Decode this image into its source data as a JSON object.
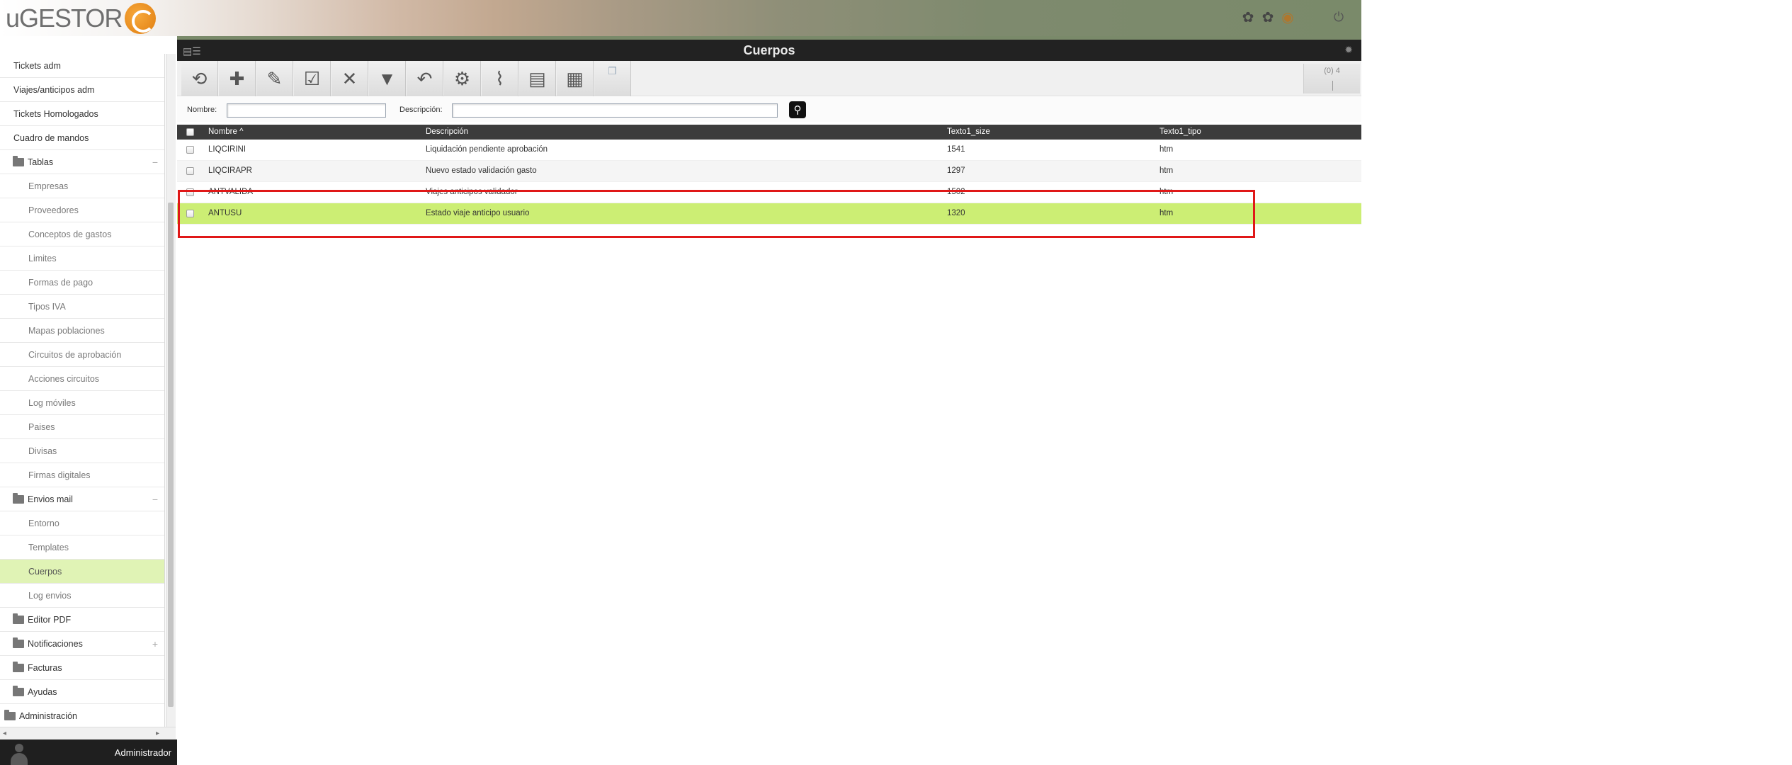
{
  "header": {
    "logo_text": "uGESTOR",
    "icons": [
      "settings-icon",
      "settings-icon",
      "globe-icon",
      "power-icon"
    ]
  },
  "sidebar": {
    "items": [
      {
        "label": "Tickets adm",
        "level": 0
      },
      {
        "label": "Viajes/anticipos adm",
        "level": 0
      },
      {
        "label": "Tickets Homologados",
        "level": 0
      },
      {
        "label": "Cuadro de mandos",
        "level": 0
      },
      {
        "label": "Tablas",
        "level": 0,
        "folder": true,
        "toggle": "−"
      },
      {
        "label": "Empresas",
        "level": 1
      },
      {
        "label": "Proveedores",
        "level": 1
      },
      {
        "label": "Conceptos de gastos",
        "level": 1
      },
      {
        "label": "Limites",
        "level": 1
      },
      {
        "label": "Formas de pago",
        "level": 1
      },
      {
        "label": "Tipos IVA",
        "level": 1
      },
      {
        "label": "Mapas poblaciones",
        "level": 1
      },
      {
        "label": "Circuitos de aprobación",
        "level": 1
      },
      {
        "label": "Acciones circuitos",
        "level": 1
      },
      {
        "label": "Log móviles",
        "level": 1
      },
      {
        "label": "Paises",
        "level": 1
      },
      {
        "label": "Divisas",
        "level": 1
      },
      {
        "label": "Firmas digitales",
        "level": 1
      },
      {
        "label": "Envios mail",
        "level": 0,
        "folder": true,
        "toggle": "−"
      },
      {
        "label": "Entorno",
        "level": 1
      },
      {
        "label": "Templates",
        "level": 1
      },
      {
        "label": "Cuerpos",
        "level": 1,
        "active": true
      },
      {
        "label": "Log envios",
        "level": 1
      },
      {
        "label": "Editor PDF",
        "level": 0,
        "folder": true
      },
      {
        "label": "Notificaciones",
        "level": 0,
        "folder": true,
        "toggle": "+"
      },
      {
        "label": "Facturas",
        "level": 0,
        "folder": true
      },
      {
        "label": "Ayudas",
        "level": 0,
        "folder": true
      },
      {
        "label": "Administración",
        "level": 0,
        "folder": true,
        "root": true
      }
    ]
  },
  "user": {
    "name": "Administrador"
  },
  "page": {
    "title": "Cuerpos",
    "record_count": "(0) 4"
  },
  "toolbar": {
    "buttons": [
      "refresh-icon",
      "add-icon",
      "edit-icon",
      "checklist-icon",
      "delete-icon",
      "filter-icon",
      "undo-icon",
      "gears-icon",
      "attach-icon",
      "pdf-icon",
      "xls-icon",
      "copy-icon"
    ]
  },
  "filters": {
    "nombre_label": "Nombre:",
    "nombre_value": "",
    "descripcion_label": "Descripción:",
    "descripcion_value": ""
  },
  "grid": {
    "columns": [
      "Nombre ^",
      "Descripción",
      "Texto1_size",
      "Texto1_tipo"
    ],
    "rows": [
      {
        "nombre": "LIQCIRINI",
        "descripcion": "Liquidación pendiente aprobación",
        "size": "1541",
        "tipo": "htm"
      },
      {
        "nombre": "LIQCIRAPR",
        "descripcion": "Nuevo estado validación gasto",
        "size": "1297",
        "tipo": "htm"
      },
      {
        "nombre": "ANTVALIDA",
        "descripcion": "Viajes anticipos validador",
        "size": "1502",
        "tipo": "htm"
      },
      {
        "nombre": "ANTUSU",
        "descripcion": "Estado viaje anticipo usuario",
        "size": "1320",
        "tipo": "htm"
      }
    ],
    "selected_row": 3
  },
  "colors": {
    "selected_row": "#ccee74",
    "active_menu": "#e0f3b5",
    "highlight_box": "#e01818",
    "title_bar": "#222222"
  }
}
